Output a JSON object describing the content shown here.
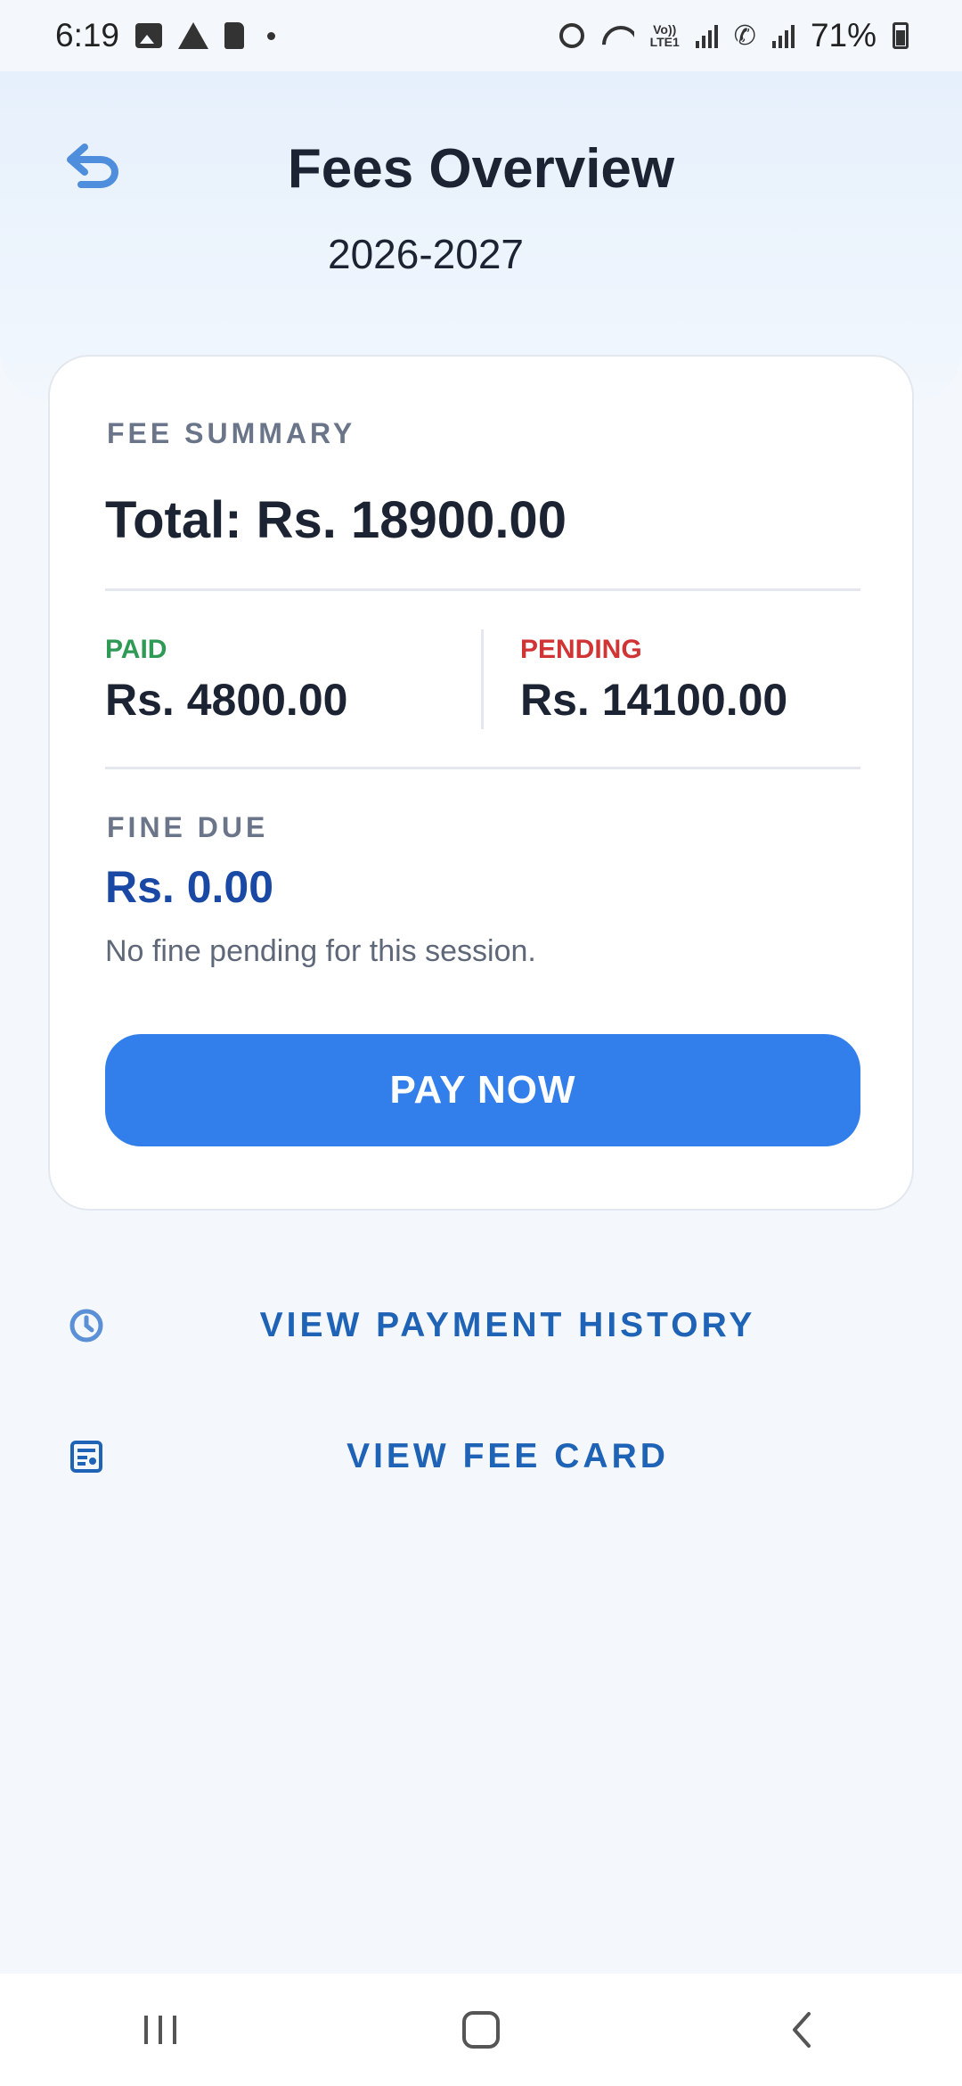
{
  "status_bar": {
    "time": "6:19",
    "battery": "71%",
    "volte": "Vo))\nLTE1"
  },
  "header": {
    "title": "Fees Overview",
    "session": "2026-2027",
    "back_icon": "undo-arrow-icon"
  },
  "summary": {
    "section_label": "FEE SUMMARY",
    "total": "Total: Rs. 18900.00",
    "paid_label": "PAID",
    "paid_value": "Rs. 4800.00",
    "pending_label": "PENDING",
    "pending_value": "Rs. 14100.00",
    "fine_label": "FINE DUE",
    "fine_value": "Rs. 0.00",
    "fine_note": "No fine pending for this session.",
    "pay_button": "PAY NOW"
  },
  "links": {
    "payment_history": "VIEW PAYMENT HISTORY",
    "fee_card": "VIEW FEE CARD"
  },
  "colors": {
    "accent": "#327fec",
    "paid": "#2f9a55",
    "pending": "#d03434",
    "fine": "#1a49a5",
    "link": "#1e63b6"
  },
  "nav": {
    "recents_icon": "recents-icon",
    "home_icon": "home-icon",
    "back_icon": "back-chevron-icon"
  }
}
